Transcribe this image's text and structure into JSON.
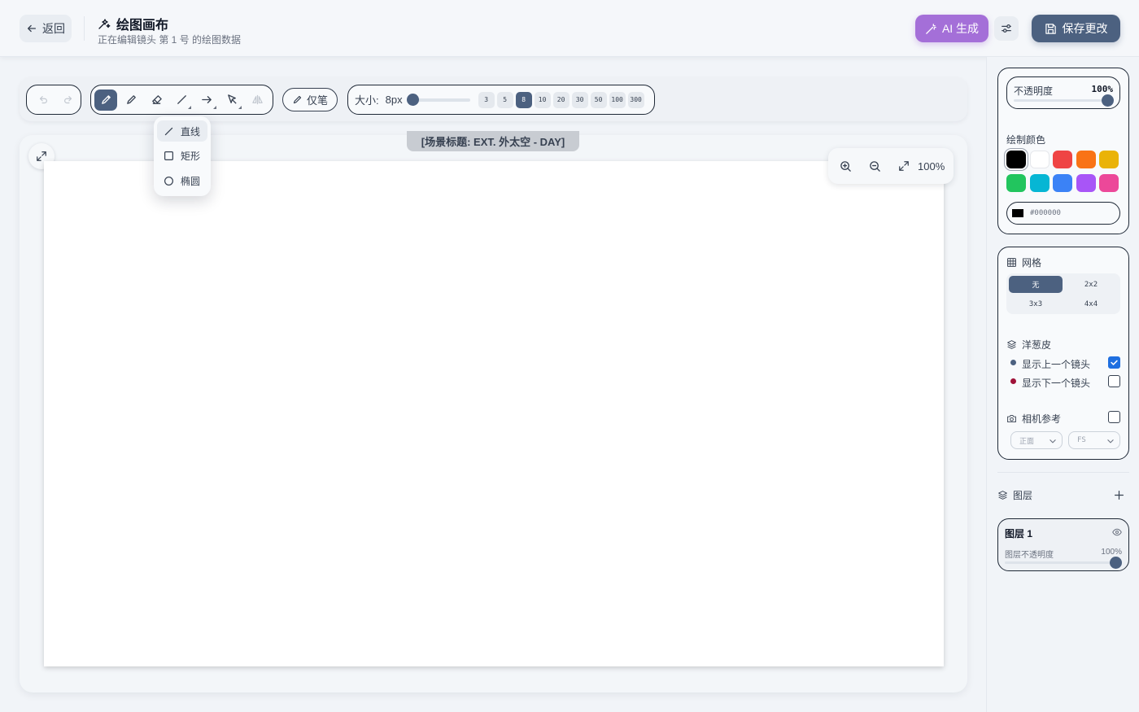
{
  "header": {
    "back_label": "返回",
    "title": "绘图画布",
    "subtitle": "正在编辑镜头 第 1 号 的绘图数据",
    "ai_label": "AI 生成",
    "save_label": "保存更改"
  },
  "toolbar": {
    "pen_only_label": "仅笔",
    "size_label": "大小:",
    "size_value": "8px",
    "size_presets": [
      "3",
      "5",
      "8",
      "10",
      "20",
      "30",
      "50",
      "100",
      "300"
    ],
    "selected_size": "8"
  },
  "shape_menu": {
    "items": [
      "直线",
      "矩形",
      "椭圆"
    ]
  },
  "canvas": {
    "scene_label": "[场景标题: EXT. 外太空 - DAY]",
    "zoom": "100%"
  },
  "sidebar": {
    "opacity_label": "不透明度",
    "opacity_value": "100%",
    "draw_color_label": "绘制颜色",
    "colors": [
      "#000000",
      "#ffffff",
      "#ef4444",
      "#f97316",
      "#eab308",
      "#22c55e",
      "#06b6d4",
      "#3b82f6",
      "#a855f7",
      "#ec4899"
    ],
    "hex_value": "#000000",
    "grid_label": "网格",
    "grid_options": [
      "无",
      "2x2",
      "3x3",
      "4x4"
    ],
    "grid_selected": "无",
    "onion_label": "洋葱皮",
    "show_prev": "显示上一个镜头",
    "show_next": "显示下一个镜头",
    "prev_checked": true,
    "next_checked": false,
    "camera_label": "相机参考",
    "camera_checked": false,
    "camera_angle": "正面",
    "camera_shot": "FS",
    "layers_label": "图层",
    "layer_name": "图层 1",
    "layer_opacity_label": "图层不透明度",
    "layer_opacity_value": "100%"
  }
}
